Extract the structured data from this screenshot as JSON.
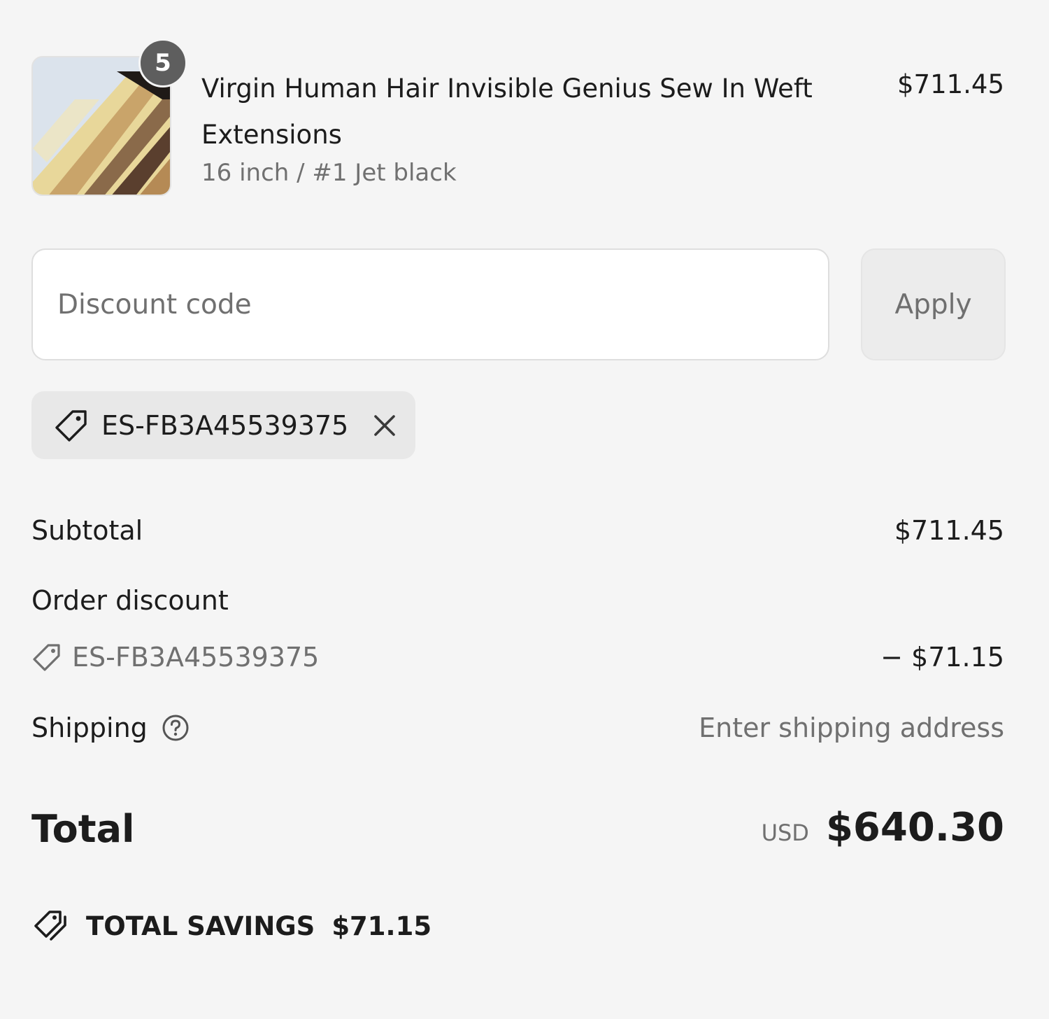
{
  "line_item": {
    "quantity": "5",
    "title": "Virgin Human Hair Invisible Genius Sew In Weft Extensions",
    "variant": "16 inch / #1 Jet black",
    "price": "$711.45"
  },
  "discount": {
    "placeholder": "Discount code",
    "apply_label": "Apply",
    "applied_code": "ES-FB3A45539375"
  },
  "summary": {
    "subtotal_label": "Subtotal",
    "subtotal_value": "$711.45",
    "order_discount_label": "Order discount",
    "order_discount_code": "ES-FB3A45539375",
    "order_discount_value": "− $71.15",
    "shipping_label": "Shipping",
    "shipping_value": "Enter shipping address"
  },
  "total": {
    "label": "Total",
    "currency": "USD",
    "amount": "$640.30"
  },
  "savings": {
    "label": "TOTAL SAVINGS",
    "value": "$71.15"
  },
  "icons": {
    "chip_tag": "tag-icon",
    "remove": "close-icon",
    "help": "help-circle-icon",
    "savings": "tags-icon"
  }
}
